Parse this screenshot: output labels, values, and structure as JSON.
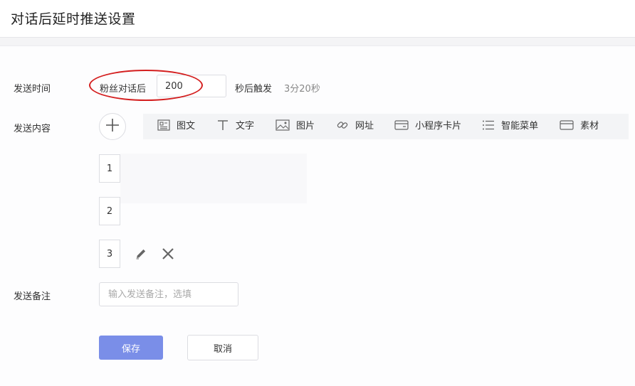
{
  "page": {
    "title": "对话后延时推送设置"
  },
  "send_time": {
    "label": "发送时间",
    "prefix": "粉丝对话后",
    "seconds_value": "200",
    "suffix": "秒后触发",
    "hint": "3分20秒"
  },
  "send_content": {
    "label": "发送内容",
    "add_icon": "plus-icon",
    "toolbar": [
      {
        "label": "图文",
        "icon": "article-icon"
      },
      {
        "label": "文字",
        "icon": "text-icon"
      },
      {
        "label": "图片",
        "icon": "image-icon"
      },
      {
        "label": "网址",
        "icon": "link-icon"
      },
      {
        "label": "小程序卡片",
        "icon": "miniprogram-card-icon"
      },
      {
        "label": "智能菜单",
        "icon": "list-icon"
      },
      {
        "label": "素材",
        "icon": "material-icon"
      }
    ],
    "items": [
      {
        "index": "1"
      },
      {
        "index": "2"
      },
      {
        "index": "3"
      }
    ],
    "item_actions": {
      "edit_icon": "pencil-icon",
      "delete_icon": "close-icon"
    }
  },
  "send_note": {
    "label": "发送备注",
    "placeholder": "输入发送备注，选填",
    "value": ""
  },
  "actions": {
    "save_label": "保存",
    "cancel_label": "取消"
  },
  "colors": {
    "primary_button": "#7a8ee8",
    "annotation_ellipse": "#d41f1f",
    "toolbar_bg": "#f3f4f6"
  }
}
